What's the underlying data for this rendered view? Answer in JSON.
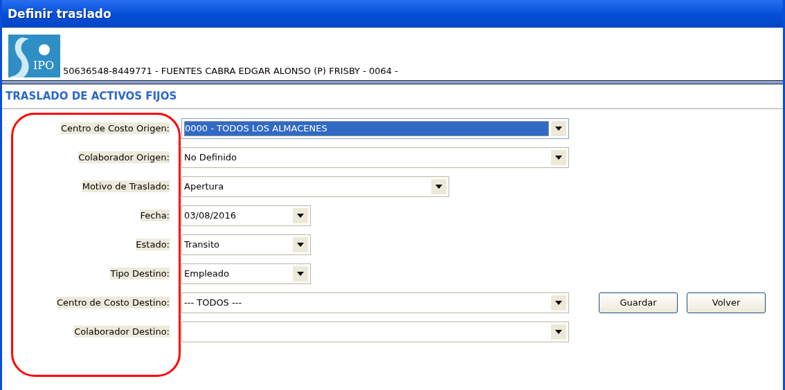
{
  "window": {
    "title": "Definir traslado"
  },
  "header": {
    "text": "50636548-8449771 - FUENTES CABRA EDGAR ALONSO (P)  FRISBY - 0064 -",
    "logo_text": "IPO"
  },
  "section_title": "TRASLADO DE ACTIVOS FIJOS",
  "fields": [
    {
      "label": "Centro de Costo Origen:",
      "value": "0000 - TODOS LOS ALMACENES",
      "focused": true
    },
    {
      "label": "Colaborador Origen:",
      "value": "No Definido",
      "focused": false
    },
    {
      "label": "Motivo de Traslado:",
      "value": "Apertura",
      "focused": false
    },
    {
      "label": "Fecha:",
      "value": "03/08/2016",
      "focused": false
    },
    {
      "label": "Estado:",
      "value": "Transito",
      "focused": false
    },
    {
      "label": "Tipo Destino:",
      "value": "Empleado",
      "focused": false
    },
    {
      "label": "Centro de Costo Destino:",
      "value": "--- TODOS ---",
      "focused": false
    },
    {
      "label": "Colaborador Destino:",
      "focused": false
    }
  ],
  "buttons": [
    {
      "label": "Guardar"
    },
    {
      "label": "Volver"
    }
  ]
}
